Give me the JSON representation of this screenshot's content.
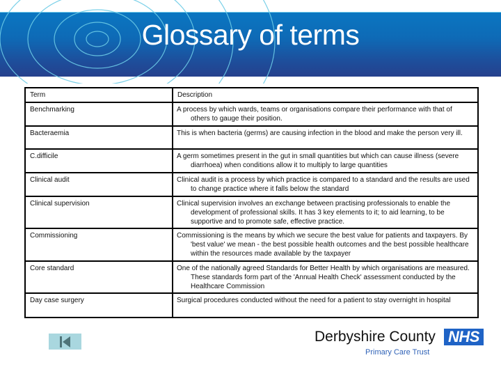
{
  "header": {
    "title": "Glossary of terms"
  },
  "table": {
    "columns": [
      "Term",
      "Description"
    ],
    "rows": [
      {
        "term": "Benchmarking",
        "description": "A process by which wards, teams or organisations compare their performance with that of others to gauge their position."
      },
      {
        "term": "Bacteraemia",
        "description": "This is when bacteria (germs) are causing infection in the blood and make the person very ill."
      },
      {
        "term": "C.difficile",
        "description": "A germ sometimes present in the gut in small quantities but which can cause illness (severe diarrhoea) when conditions allow it to multiply to large quantities"
      },
      {
        "term": "Clinical audit",
        "description": "Clinical audit is a process by which practice is compared to a standard and the results are used to change practice where it  falls below the standard"
      },
      {
        "term": "Clinical supervision",
        "description": "Clinical supervision involves an exchange between practising professionals to enable the development of professional skills. It has 3 key elements to it; to aid learning, to be supportive and to promote safe, effective practice."
      },
      {
        "term": "Commissioning",
        "description": "Commissioning is the means by which we secure the best value for patients and taxpayers. By 'best value' we mean - the best possible health outcomes and the best possible healthcare within the resources made available by the taxpayer"
      },
      {
        "term": "Core standard",
        "description": "One of the nationally agreed Standards for Better Health by which organisations are measured. These standards form part of the 'Annual Health Check' assessment conducted by the Healthcare Commission"
      },
      {
        "term": "Day case surgery",
        "description": "Surgical procedures conducted without the need for a patient to stay overnight in hospital"
      }
    ]
  },
  "navigation": {
    "first_slide_icon": "skip-to-first-icon"
  },
  "logo": {
    "name": "Derbyshire County",
    "badge": "NHS",
    "subtitle": "Primary Care Trust"
  },
  "colors": {
    "banner_top": "#0a76c1",
    "banner_bottom": "#25408d",
    "ring": "#6ccbe6",
    "nav_button": "#a9d7df",
    "nav_icon": "#4f7479",
    "nhs_blue": "#1f63c6",
    "subtitle_blue": "#2f62b7"
  }
}
